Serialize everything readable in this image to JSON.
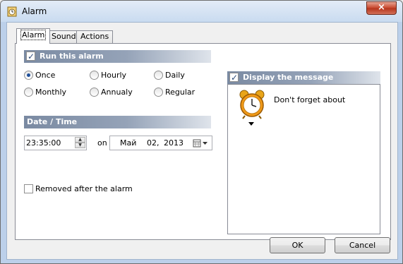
{
  "window": {
    "title": "Alarm",
    "close_glyph": "×"
  },
  "tabs": [
    {
      "label": "Alarm"
    },
    {
      "label": "Sound"
    },
    {
      "label": "Actions"
    }
  ],
  "run_section": {
    "label": "Run this alarm",
    "checked": true
  },
  "recurrence": {
    "options": [
      {
        "label": "Once",
        "checked": true
      },
      {
        "label": "Hourly",
        "checked": false
      },
      {
        "label": "Daily",
        "checked": false
      },
      {
        "label": "Monthly",
        "checked": false
      },
      {
        "label": "Annualy",
        "checked": false
      },
      {
        "label": "Regular",
        "checked": false
      }
    ]
  },
  "datetime": {
    "header": "Date / Time",
    "time_value": "23:35:00",
    "on_label": "on",
    "date_month": "Май",
    "date_day": "02,",
    "date_year": "2013"
  },
  "removed_after": {
    "label": "Removed after the alarm",
    "checked": false
  },
  "message_section": {
    "label": "Display the message",
    "checked": true,
    "text": "Don't forget about",
    "icon": "alarm-clock-icon"
  },
  "buttons": {
    "ok": "OK",
    "cancel": "Cancel"
  }
}
